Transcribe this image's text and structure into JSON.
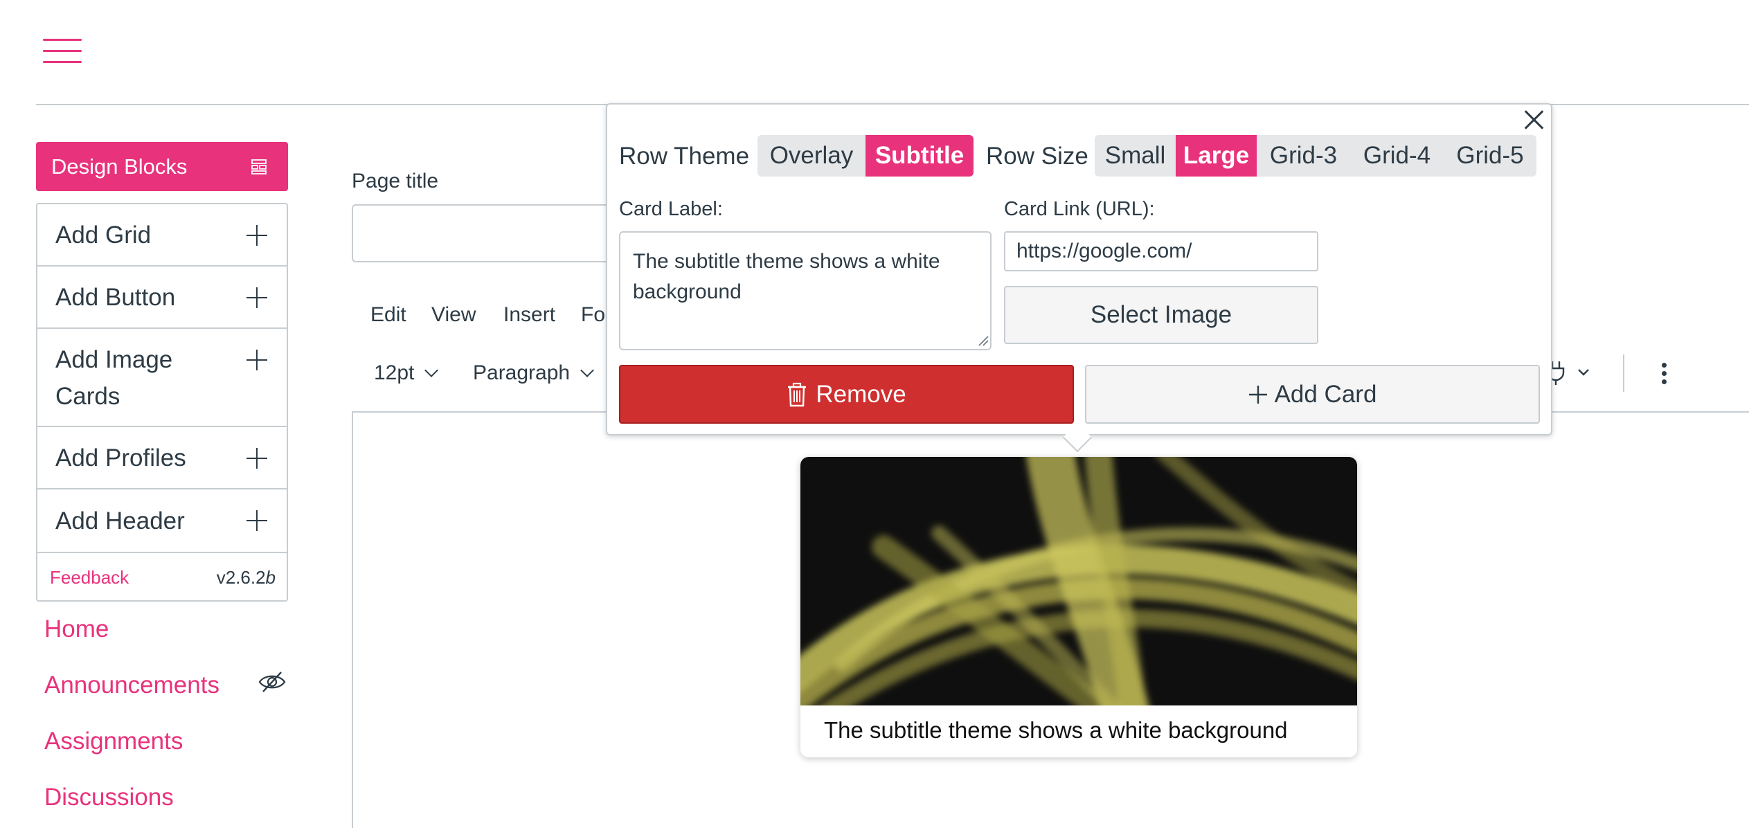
{
  "design_blocks": {
    "title": "Design Blocks",
    "items": [
      {
        "label": "Add Grid"
      },
      {
        "label": "Add Button"
      },
      {
        "label": "Add Image Cards",
        "line1": "Add Image",
        "line2": "Cards"
      },
      {
        "label": "Add Profiles"
      },
      {
        "label": "Add Header"
      }
    ],
    "feedback": "Feedback",
    "version": "v2.6.2",
    "version_suffix": "b"
  },
  "course_nav": [
    "Home",
    "Announcements",
    "Assignments",
    "Discussions"
  ],
  "editor": {
    "page_title_label": "Page title",
    "page_title_value": "",
    "menu": [
      "Edit",
      "View",
      "Insert",
      "Fo"
    ],
    "font_size": "12pt",
    "block_format": "Paragraph"
  },
  "popover": {
    "row_theme_label": "Row Theme",
    "row_theme_options": [
      "Overlay",
      "Subtitle"
    ],
    "row_theme_selected": "Subtitle",
    "row_size_label": "Row Size",
    "row_size_options": [
      "Small",
      "Large",
      "Grid-3",
      "Grid-4",
      "Grid-5"
    ],
    "row_size_selected": "Large",
    "card_label_label": "Card Label:",
    "card_label_value": "The subtitle theme shows a white background",
    "card_link_label": "Card Link (URL):",
    "card_link_value": "https://google.com/",
    "select_image": "Select Image",
    "remove": "Remove",
    "add_card": "Add Card"
  },
  "card": {
    "caption": "The subtitle theme shows a white background"
  },
  "colors": {
    "accent": "#e8327c",
    "danger": "#d02f2f",
    "text": "#2d3b45",
    "border": "#c7cdd1"
  },
  "icons": [
    "hamburger-icon",
    "blocks-icon",
    "plus-icon",
    "eye-off-icon",
    "close-icon",
    "trash-icon",
    "plug-icon",
    "kebab-icon",
    "chevron-down-icon"
  ]
}
